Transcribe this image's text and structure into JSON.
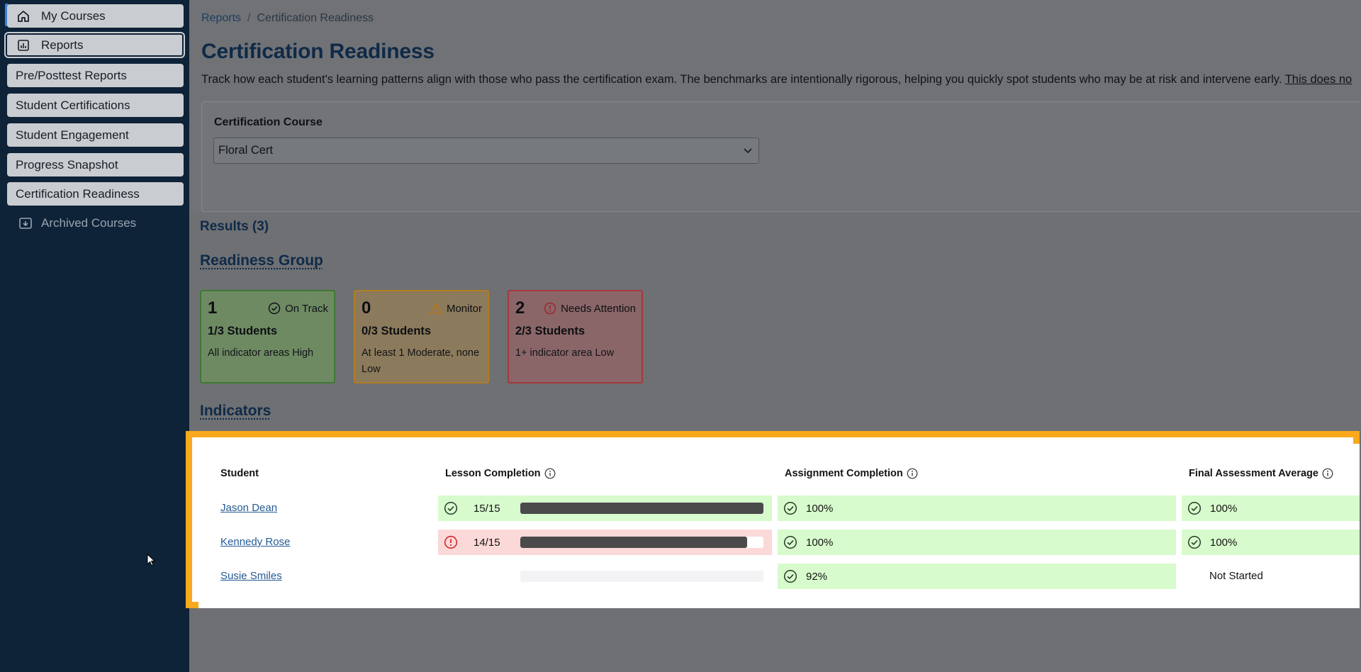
{
  "sidebar": {
    "items": [
      {
        "label": "My Courses",
        "icon": "home-icon"
      },
      {
        "label": "Reports",
        "icon": "chart-icon"
      },
      {
        "label": "Pre/Posttest Reports"
      },
      {
        "label": "Student Certifications"
      },
      {
        "label": "Student Engagement"
      },
      {
        "label": "Progress Snapshot"
      },
      {
        "label": "Certification Readiness"
      }
    ],
    "archived": {
      "label": "Archived Courses",
      "icon": "archive-icon"
    }
  },
  "breadcrumb": {
    "parent": "Reports",
    "separator": "/",
    "current": "Certification Readiness"
  },
  "page": {
    "title": "Certification Readiness",
    "description": "Track how each student's learning patterns align with those who pass the certification exam. The benchmarks are intentionally rigorous, helping you quickly spot students who may be at risk and intervene early.",
    "description_link": "This does no"
  },
  "filter": {
    "label": "Certification Course",
    "value": "Floral Cert"
  },
  "results": {
    "label": "Results (3)"
  },
  "readiness": {
    "heading": "Readiness Group",
    "groups": [
      {
        "count": "1",
        "status": "On Track",
        "students": "1/3 Students",
        "desc": "All indicator areas High",
        "color": "#3e7a34"
      },
      {
        "count": "0",
        "status": "Monitor",
        "students": "0/3 Students",
        "desc": "At least 1 Moderate, none Low",
        "color": "#b27c25"
      },
      {
        "count": "2",
        "status": "Needs Attention",
        "students": "2/3 Students",
        "desc": "1+ indicator area Low",
        "color": "#a4393d"
      }
    ]
  },
  "indicators": {
    "heading": "Indicators",
    "columns": [
      "Student",
      "Lesson Completion",
      "Assignment Completion",
      "Final Assessment Average"
    ],
    "rows": [
      {
        "student": "Jason Dean",
        "lesson": "15/15",
        "lesson_fraction": 1.0,
        "lesson_status": "good",
        "assignment": "100%",
        "final": "100%"
      },
      {
        "student": "Kennedy Rose",
        "lesson": "14/15",
        "lesson_fraction": 0.933,
        "lesson_status": "low",
        "assignment": "100%",
        "final": "100%"
      },
      {
        "student": "Susie Smiles",
        "lesson": "",
        "lesson_fraction": 0,
        "lesson_status": "none",
        "assignment": "92%",
        "final": "Not Started"
      }
    ]
  },
  "colors": {
    "highlight": "#fba91c",
    "good_bg": "#d7fbcc",
    "low_bg": "#fbd9d8",
    "sidebar": "#0e2238",
    "accent": "#3c82d4"
  }
}
